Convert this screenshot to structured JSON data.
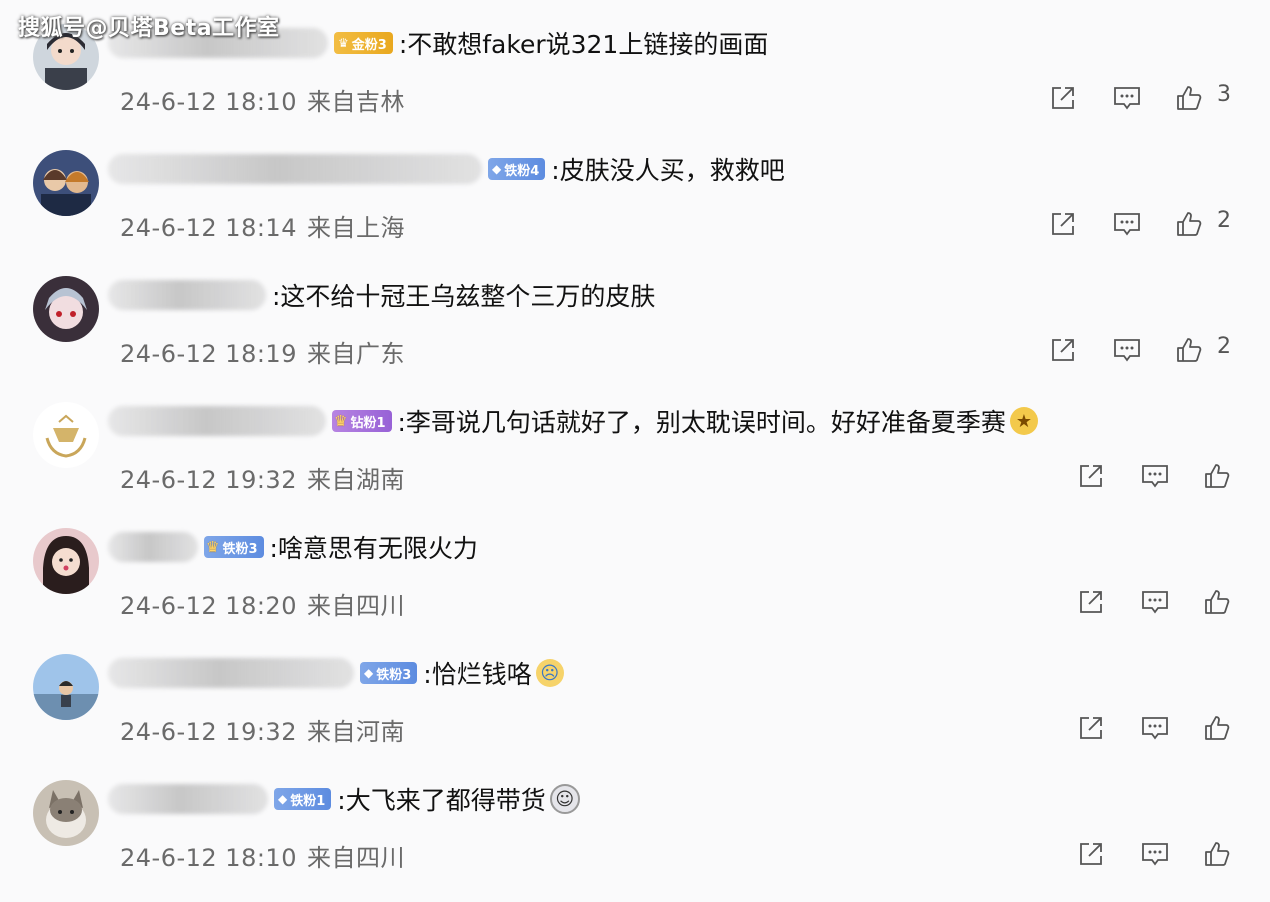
{
  "watermark": "搜狐号@贝塔Beta工作室",
  "colors": {
    "gold_badge": "#eeb332",
    "iron_badge": "#6c98e4",
    "diamond_badge": "#a46ddc",
    "meta_text": "#6a6a6a"
  },
  "icons": {
    "share": "share-icon",
    "reply": "comment-icon",
    "like": "thumbs-up-icon"
  },
  "comments": [
    {
      "badge": "金粉3",
      "text": ":不敢想faker说321上链接的画面",
      "date": "24-6-12 18:10",
      "location": "来自吉林",
      "likes": "3"
    },
    {
      "badge": "铁粉4",
      "text": ":皮肤没人买，救救吧",
      "date": "24-6-12 18:14",
      "location": "来自上海",
      "likes": "2"
    },
    {
      "badge": "",
      "text": ":这不给十冠王乌兹整个三万的皮肤",
      "date": "24-6-12 18:19",
      "location": "来自广东",
      "likes": "2"
    },
    {
      "badge": "钻粉1",
      "text": ":李哥说几句话就好了，别太耽误时间。好好准备夏季赛",
      "date": "24-6-12 19:32",
      "location": "来自湖南",
      "likes": ""
    },
    {
      "badge": "铁粉3",
      "text": ":啥意思有无限火力",
      "date": "24-6-12 18:20",
      "location": "来自四川",
      "likes": ""
    },
    {
      "badge": "铁粉3",
      "text": ":恰烂钱咯",
      "date": "24-6-12 19:32",
      "location": "来自河南",
      "likes": ""
    },
    {
      "badge": "铁粉1",
      "text": ":大飞来了都得带货",
      "date": "24-6-12 18:10",
      "location": "来自四川",
      "likes": ""
    }
  ]
}
